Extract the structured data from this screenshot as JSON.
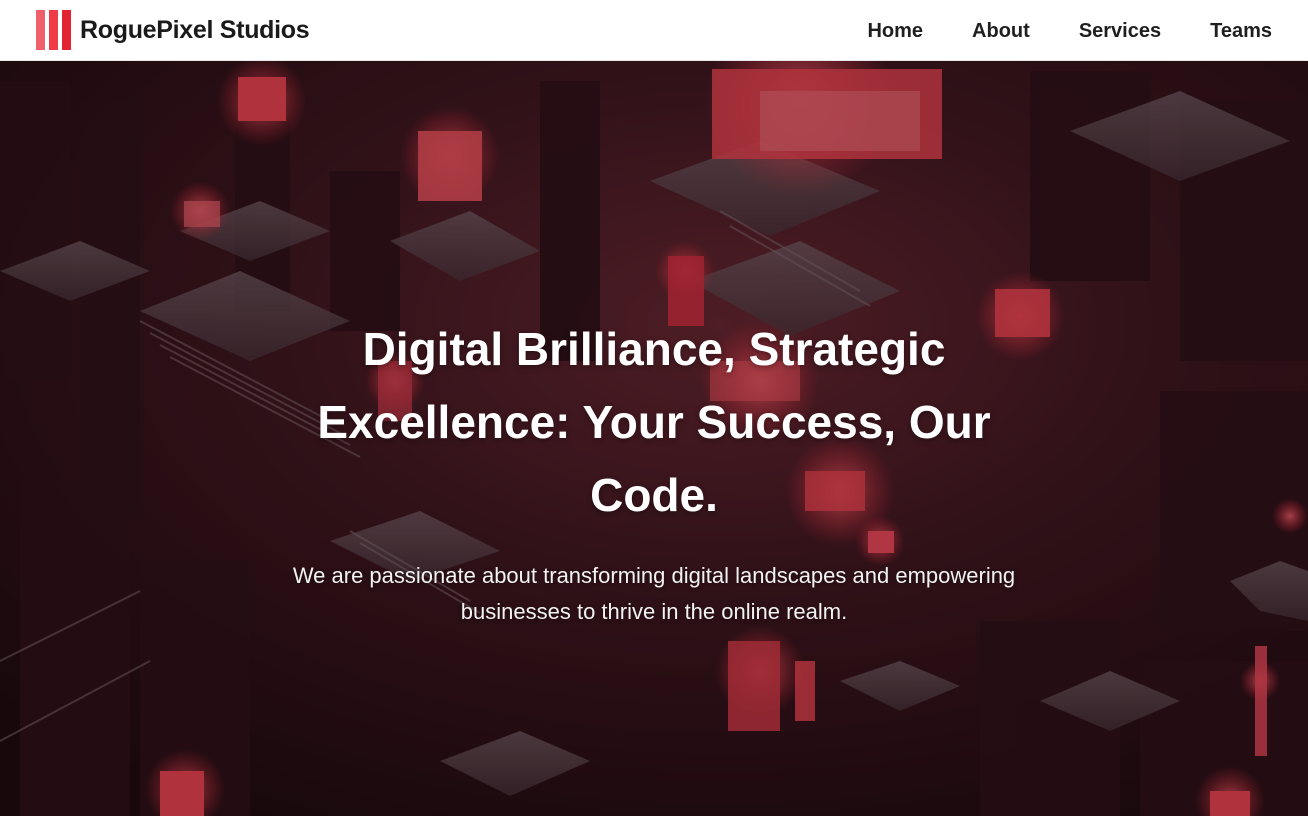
{
  "brand": {
    "name": "RoguePixel Studios",
    "logo_icon": "red-bars-logo-icon",
    "logo_colors": [
      "#f0606a",
      "#ee3b47",
      "#e32232"
    ]
  },
  "nav": {
    "items": [
      {
        "label": "Home"
      },
      {
        "label": "About"
      },
      {
        "label": "Services"
      },
      {
        "label": "Teams"
      }
    ]
  },
  "hero": {
    "title": "Digital Brilliance, Strategic Excellence: Your Success, Our Code.",
    "subtitle": "We are passionate about transforming digital landscapes and empowering businesses to thrive in the online realm.",
    "background_image": "red-isometric-circuit-city-image",
    "accent_color": "#ff3a4a"
  }
}
